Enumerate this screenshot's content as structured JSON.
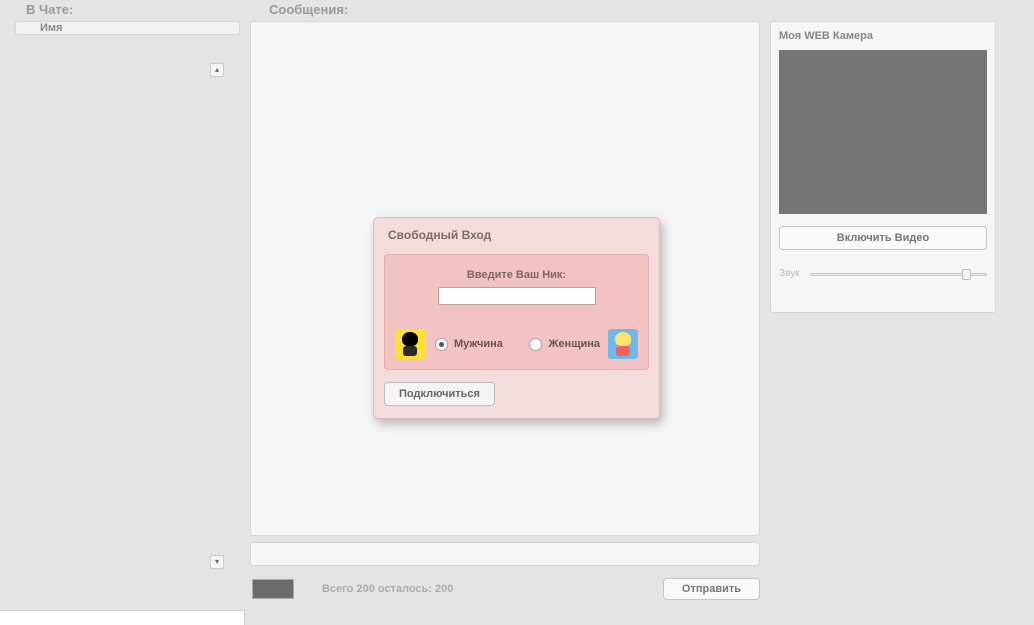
{
  "labels": {
    "in_chat": "В Чате:",
    "messages": "Сообщения:",
    "name": "Имя"
  },
  "camera": {
    "title": "Моя WEB Камера",
    "enable_video": "Включить Видео",
    "sound": "Звук"
  },
  "footer": {
    "remaining": "Всего 200 осталось: 200",
    "send": "Отправить"
  },
  "modal": {
    "title": "Свободный Вход",
    "enter_nick": "Введите Ваш Ник:",
    "nick_value": "",
    "male": "Мужчина",
    "female": "Женщина",
    "selected_gender": "male",
    "connect": "Подключиться"
  }
}
